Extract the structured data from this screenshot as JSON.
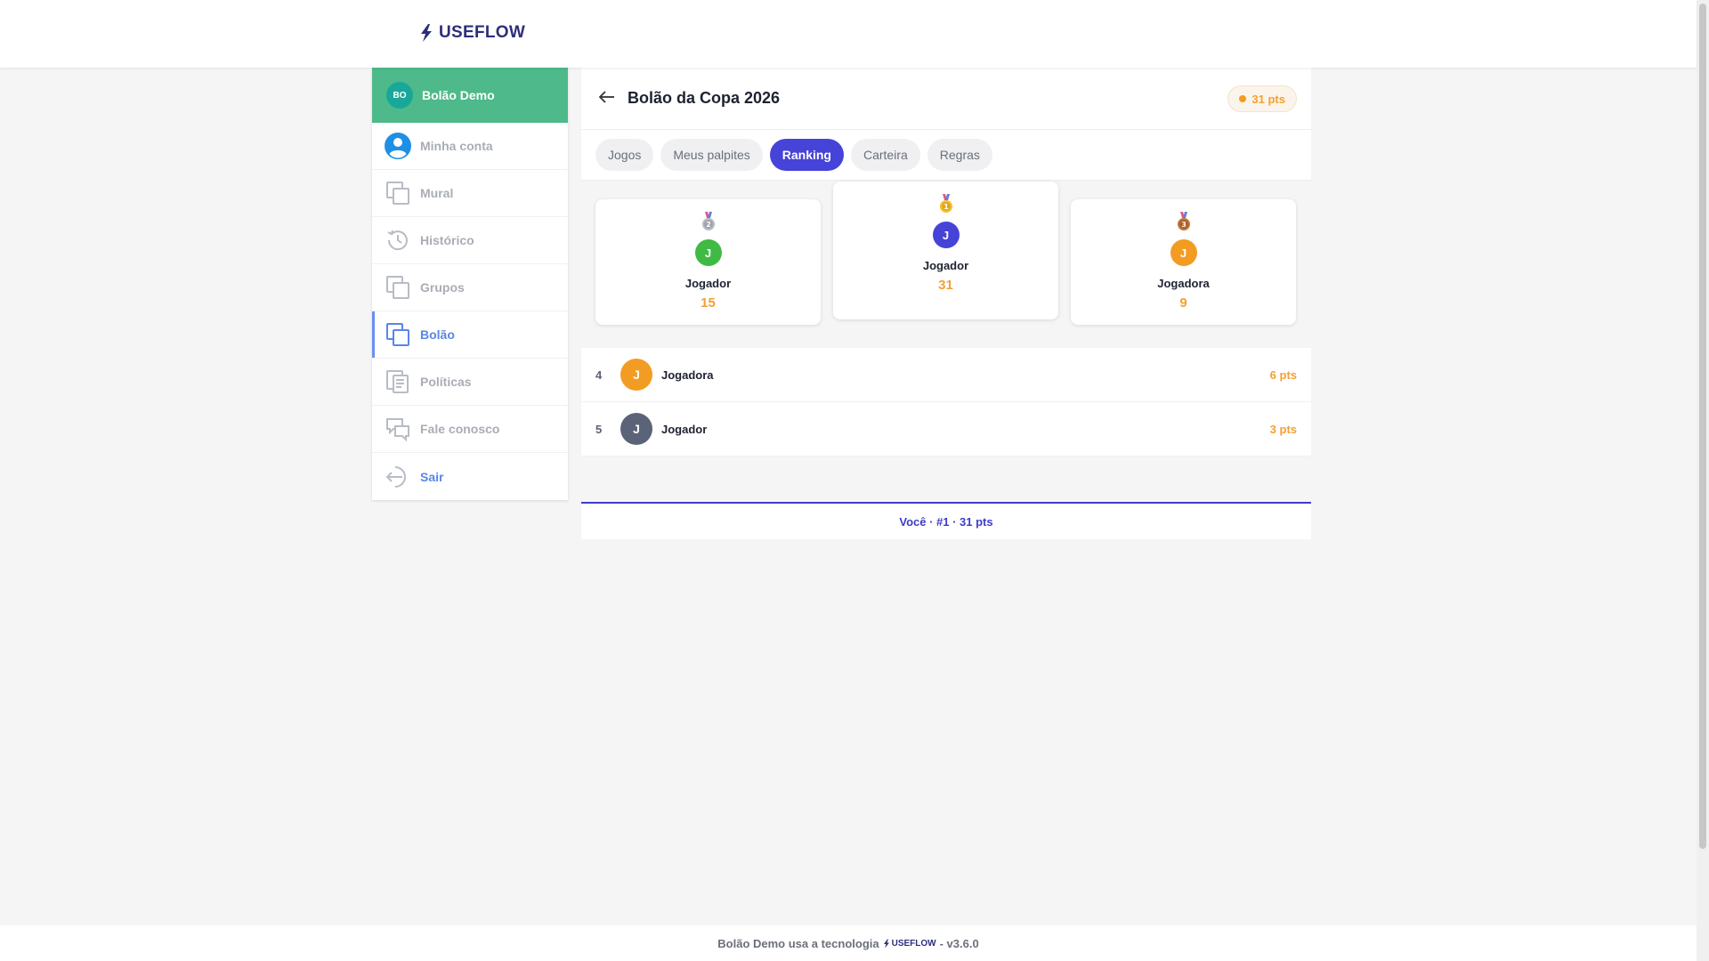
{
  "header": {
    "logo_text": "USEFLOW"
  },
  "sidebar": {
    "head": {
      "avatar_initials": "BO",
      "label": "Bolão Demo"
    },
    "items": [
      {
        "label": "Minha conta",
        "icon": "user-circle-icon"
      },
      {
        "label": "Mural",
        "icon": "copy-icon"
      },
      {
        "label": "Histórico",
        "icon": "history-icon"
      },
      {
        "label": "Grupos",
        "icon": "copy-icon"
      },
      {
        "label": "Bolão",
        "icon": "copy-icon",
        "active": true
      },
      {
        "label": "Políticas",
        "icon": "document-icon"
      },
      {
        "label": "Fale conosco",
        "icon": "chat-icon"
      },
      {
        "label": "Sair",
        "icon": "logout-icon"
      }
    ]
  },
  "main": {
    "title": "Bolão da Copa 2026",
    "points_badge": "31 pts",
    "tabs": [
      "Jogos",
      "Meus palpites",
      "Ranking",
      "Carteira",
      "Regras"
    ],
    "active_tab": "Ranking",
    "podium": {
      "first": {
        "initial": "J",
        "name": "Jogador",
        "score": "31",
        "medal": "1",
        "color": "#4643d9"
      },
      "second": {
        "initial": "J",
        "name": "Jogador",
        "score": "15",
        "medal": "2",
        "color": "#3fba44"
      },
      "third": {
        "initial": "J",
        "name": "Jogadora",
        "score": "9",
        "medal": "3",
        "color": "#f39c23"
      }
    },
    "ranking": [
      {
        "pos": "4",
        "initial": "J",
        "name": "Jogadora",
        "pts": "6 pts",
        "color": "#f39c23"
      },
      {
        "pos": "5",
        "initial": "J",
        "name": "Jogador",
        "pts": "3 pts",
        "color": "#5a6378"
      }
    ],
    "you_banner": "Você · #1 · 31 pts"
  },
  "footer": {
    "text_before": "Bolão Demo usa a tecnologia",
    "logo_text": "USEFLOW",
    "version": "- v3.6.0"
  }
}
